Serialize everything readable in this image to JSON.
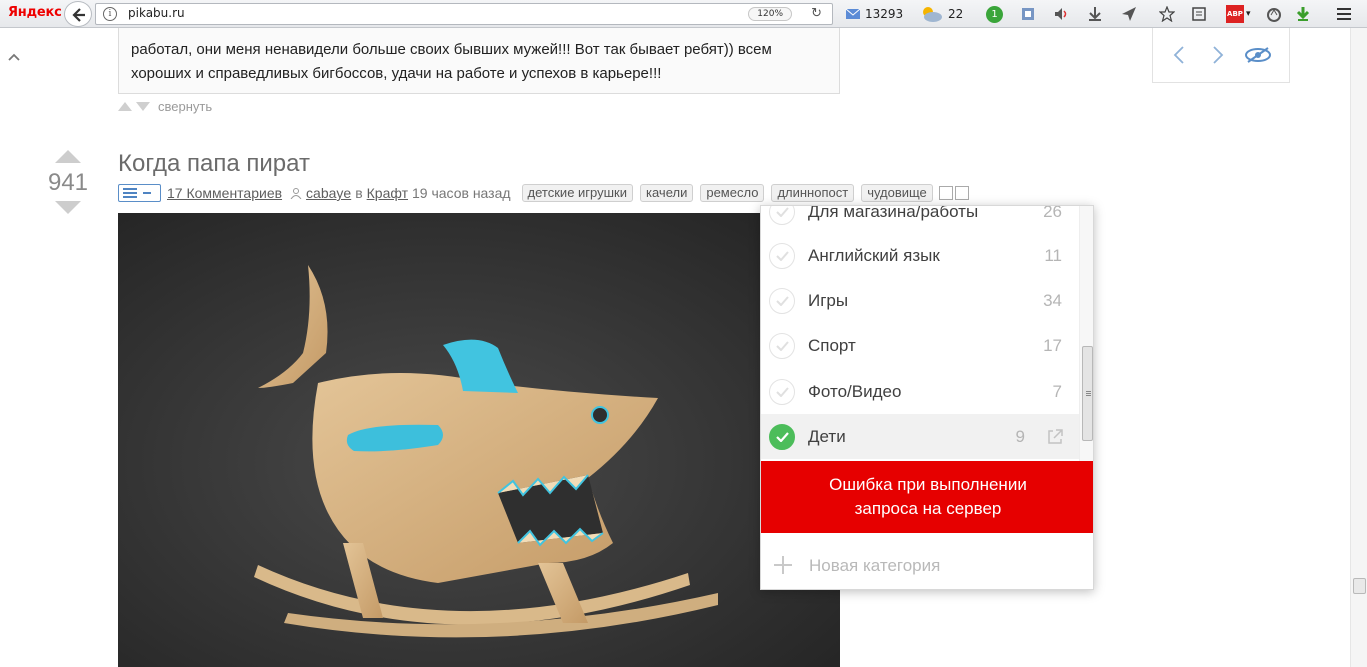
{
  "browser": {
    "brand": "Яндекс",
    "url": "pikabu.ru",
    "zoom": "120%",
    "mail_count": "13293",
    "weather_temp": "22",
    "badge_count": "1",
    "abp_label": "ABP"
  },
  "comment": {
    "line1": "работал, они меня ненавидели больше своих бывших мужей!!! Вот так бывает ребят)) всем",
    "line2": "хороших и справедливых бигбоссов, удачи на работе и успехов в карьере!!!",
    "collapse_label": "свернуть"
  },
  "post": {
    "rating": "941",
    "title": "Когда папа пират",
    "comments_link": "17 Комментариев",
    "author": "cabaye",
    "in_word": "в",
    "community": "Крафт",
    "time": "19 часов назад",
    "tags": [
      "детские игрушки",
      "качели",
      "ремесло",
      "длиннопост",
      "чудовище"
    ]
  },
  "category_dropdown": {
    "items": [
      {
        "label": "Для магазина/работы",
        "count": "26",
        "checked": false
      },
      {
        "label": "Английский язык",
        "count": "11",
        "checked": false
      },
      {
        "label": "Игры",
        "count": "34",
        "checked": false
      },
      {
        "label": "Спорт",
        "count": "17",
        "checked": false
      },
      {
        "label": "Фото/Видео",
        "count": "7",
        "checked": false
      },
      {
        "label": "Дети",
        "count": "9",
        "checked": true
      }
    ],
    "error_line1": "Ошибка при выполнении",
    "error_line2": "запроса на сервер",
    "new_category": "Новая категория"
  },
  "colors": {
    "error_bg": "#e60000",
    "check_green": "#4cbd5a",
    "link_blue": "#4f84c2"
  }
}
